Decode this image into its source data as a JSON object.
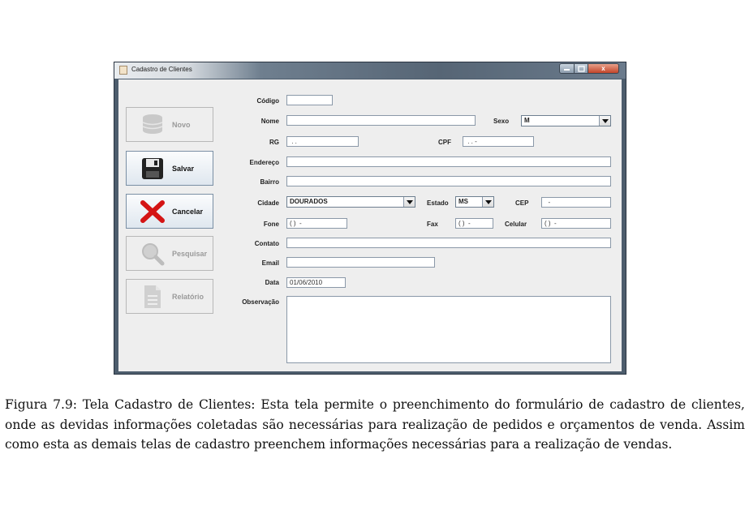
{
  "window": {
    "title": "Cadastro de Clientes",
    "close_glyph": "x"
  },
  "sidebar": {
    "buttons": [
      {
        "label": "Novo",
        "icon": "database-icon",
        "enabled": false
      },
      {
        "label": "Salvar",
        "icon": "floppy-disk-icon",
        "enabled": true
      },
      {
        "label": "Cancelar",
        "icon": "red-x-icon",
        "enabled": true
      },
      {
        "label": "Pesquisar",
        "icon": "magnifier-icon",
        "enabled": false
      },
      {
        "label": "Relatório",
        "icon": "document-icon",
        "enabled": false
      }
    ]
  },
  "form": {
    "labels": {
      "codigo": "Código",
      "nome": "Nome",
      "sexo": "Sexo",
      "rg": "RG",
      "cpf": "CPF",
      "endereco": "Endereço",
      "bairro": "Bairro",
      "cidade": "Cidade",
      "estado": "Estado",
      "cep": "CEP",
      "fone": "Fone",
      "fax": "Fax",
      "celular": "Celular",
      "contato": "Contato",
      "email": "Email",
      "data": "Data",
      "observacao": "Observação"
    },
    "values": {
      "codigo": "",
      "nome": "",
      "sexo": "M",
      "rg": " . .",
      "cpf": " . . -",
      "endereco": "",
      "bairro": "",
      "cidade": "DOURADOS",
      "estado": "MS",
      "cep": "  -",
      "fone": "( )  -",
      "fax": "( )  -",
      "celular": "( )  -",
      "contato": "",
      "email": "",
      "data": "01/06/2010",
      "observacao": ""
    }
  },
  "caption": "Figura 7.9: Tela Cadastro de Clientes: Esta tela permite o preenchimento do formulário de cadastro de clientes, onde as devidas informações coletadas são necessárias para realização de pedidos e orçamentos de venda. Assim como esta as demais telas de cadastro preenchem informações necessárias para a realização de vendas."
}
